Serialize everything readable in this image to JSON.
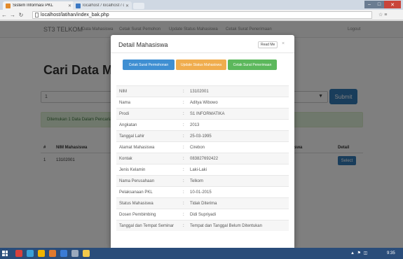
{
  "browser": {
    "tabs": [
      {
        "label": "Sistem Informasi PKL"
      },
      {
        "label": "localhost / localhost / dt"
      }
    ],
    "url": "localhost/latihan/index_bak.php",
    "window_controls": {
      "minimize": "‒",
      "maximize": "□",
      "close": "✕"
    }
  },
  "page": {
    "brand": "ST3 TELKOM",
    "nav_items": [
      "Data Mahasiswa",
      "Cetak Surat Pemohon",
      "Update Status Mahasiswa",
      "Cetak Surat Penerimaan"
    ],
    "logout": "Logout",
    "heading": "Cari Data Maha",
    "select_value": "1",
    "submit_label": "Submit",
    "alert_text": "Ditemukan 1 Data Dalam Pencarian",
    "table_headers": {
      "num": "#",
      "nim": "NIM Mahasiswa",
      "status": "swa",
      "detail": "Detail"
    },
    "rows": [
      {
        "num": "1",
        "nim": "13102001",
        "action": "Select"
      }
    ]
  },
  "modal": {
    "title": "Detail Mahasiswa",
    "read_me": "Read Me",
    "close_symbol": "×",
    "buttons": {
      "cetak_permohonan": "Cetak Surat Permohonan",
      "update_status": "Update Status Mahasiswa",
      "cetak_penerimaan": "Cetak Surat Penerimaan"
    },
    "fields": [
      {
        "label": "NIM",
        "value": "13102001"
      },
      {
        "label": "Nama",
        "value": "Aditya Wibowo"
      },
      {
        "label": "Prodi",
        "value": "S1 INFORMATIKA"
      },
      {
        "label": "Angkatan",
        "value": "2013"
      },
      {
        "label": "Tanggal Lahir",
        "value": "25-03-1995"
      },
      {
        "label": "Alamat Mahasiswa",
        "value": "Cirebon"
      },
      {
        "label": "Kontak",
        "value": "083827692422"
      },
      {
        "label": "Jenis Kelamin",
        "value": "Laki-Laki"
      },
      {
        "label": "Nama Perusahaan",
        "value": "Telkom"
      },
      {
        "label": "Pelaksanaan PKL",
        "value": "10-01-2015"
      },
      {
        "label": "Status Mahasiswa",
        "value": "Tidak Diterima"
      },
      {
        "label": "Dosen Pembimbing",
        "value": "Didi Supriyadi"
      },
      {
        "label": "Tanggal dan Tempat Seminar",
        "value": "Tempat dan Tanggal Belum Ditentukan"
      }
    ]
  },
  "taskbar": {
    "clock": "9:35",
    "task_icon_colors": [
      "#d9413b",
      "#3aa0d8",
      "#f0b400",
      "#e07a2e",
      "#3a7bd5",
      "#9aa9bd",
      "#f2c94c"
    ]
  },
  "colors": {
    "primary": "#337ab7",
    "warning": "#f0ad4e",
    "success": "#5cb85c",
    "taskbar": "#2a4d7a"
  }
}
